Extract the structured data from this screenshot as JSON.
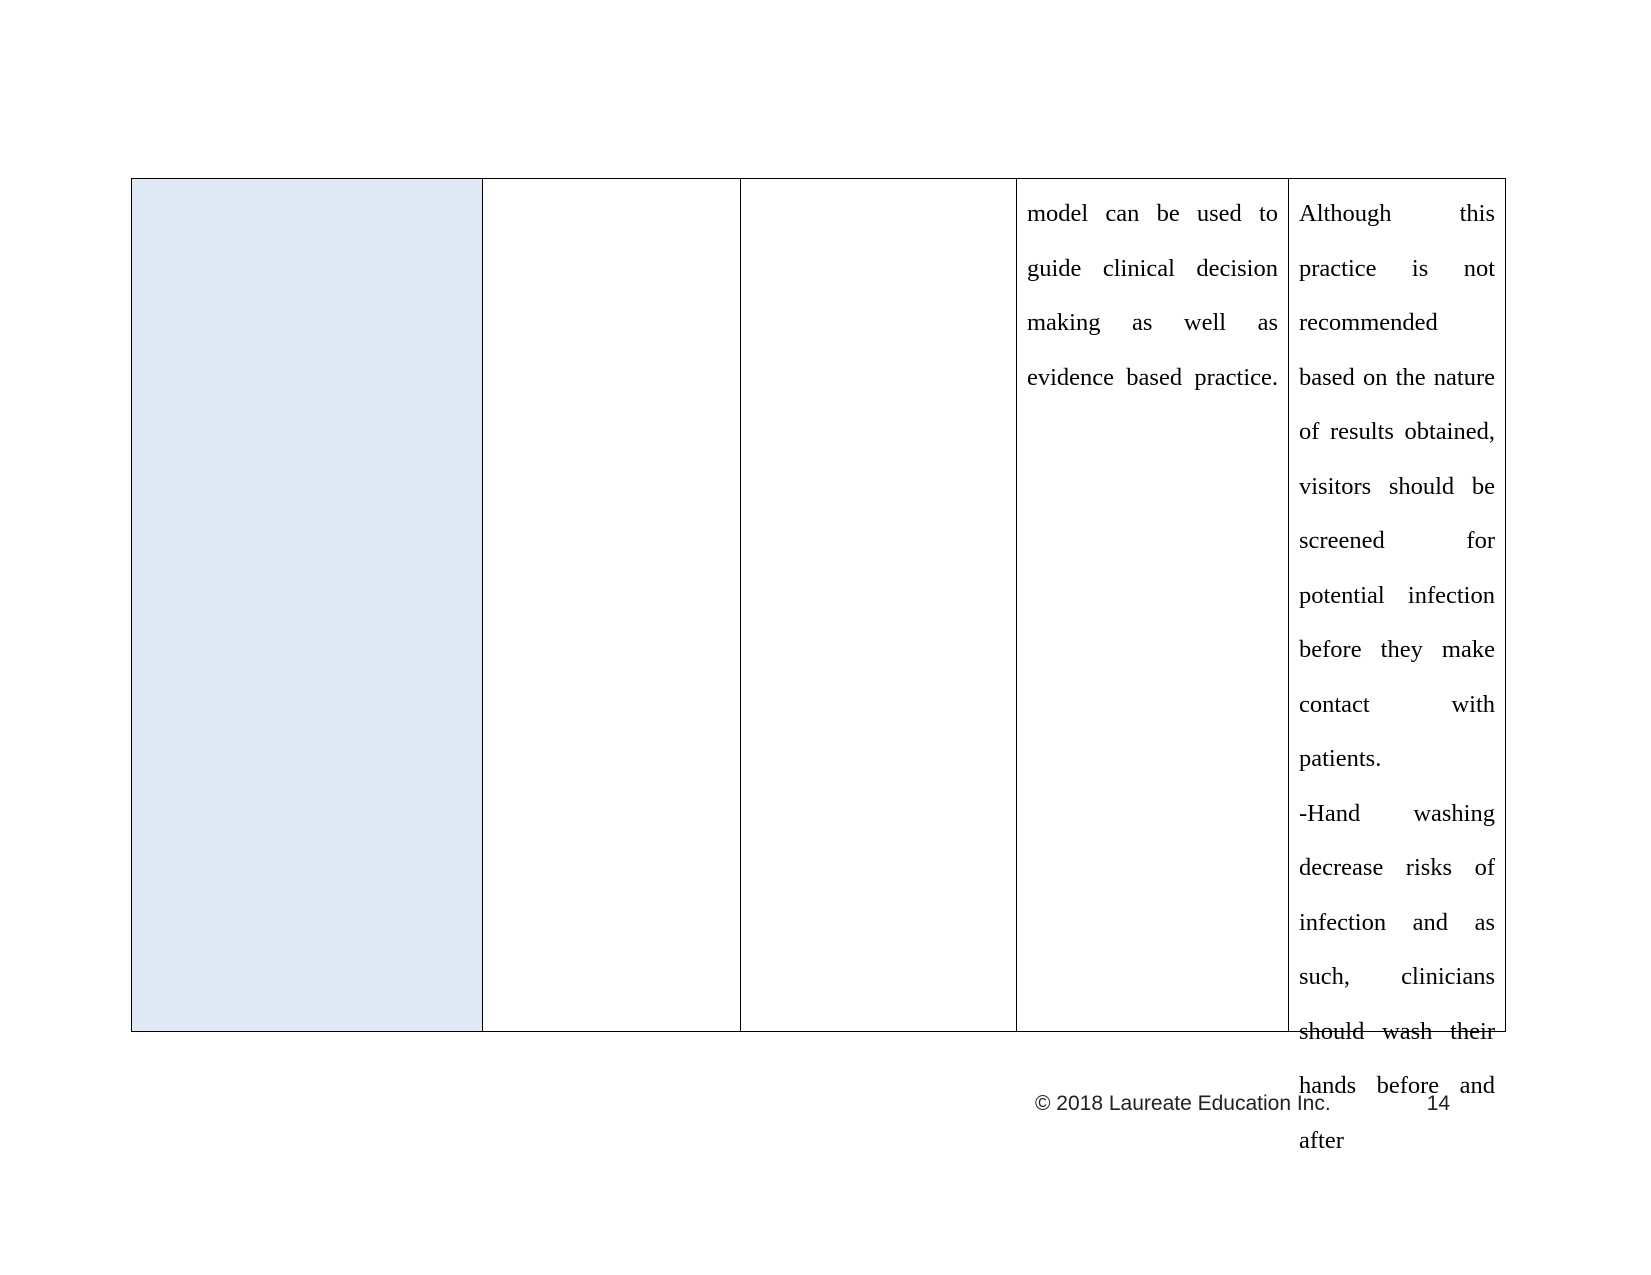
{
  "document": {
    "page_number": "14",
    "copyright": "© 2018 Laureate Education Inc."
  },
  "table": {
    "columns": [
      {
        "id": "col-1",
        "shaded": true,
        "fill_color": "#dfe8f5",
        "content": ""
      },
      {
        "id": "col-2",
        "shaded": false,
        "fill_color": "#ffffff",
        "content": ""
      },
      {
        "id": "col-3",
        "shaded": false,
        "fill_color": "#ffffff",
        "content": ""
      },
      {
        "id": "col-4",
        "shaded": false,
        "fill_color": "#ffffff",
        "content": "model can be used to guide clinical decision making as well as evidence based practice."
      },
      {
        "id": "col-5",
        "shaded": false,
        "fill_color": "#ffffff",
        "paragraph_1": "Although this practice is not recommended based on the nature of results obtained, visitors should be screened for potential infection before they make contact with patients.",
        "paragraph_2": "-Hand washing decrease risks of infection and as such, clinicians should wash their hands before and after"
      }
    ]
  }
}
